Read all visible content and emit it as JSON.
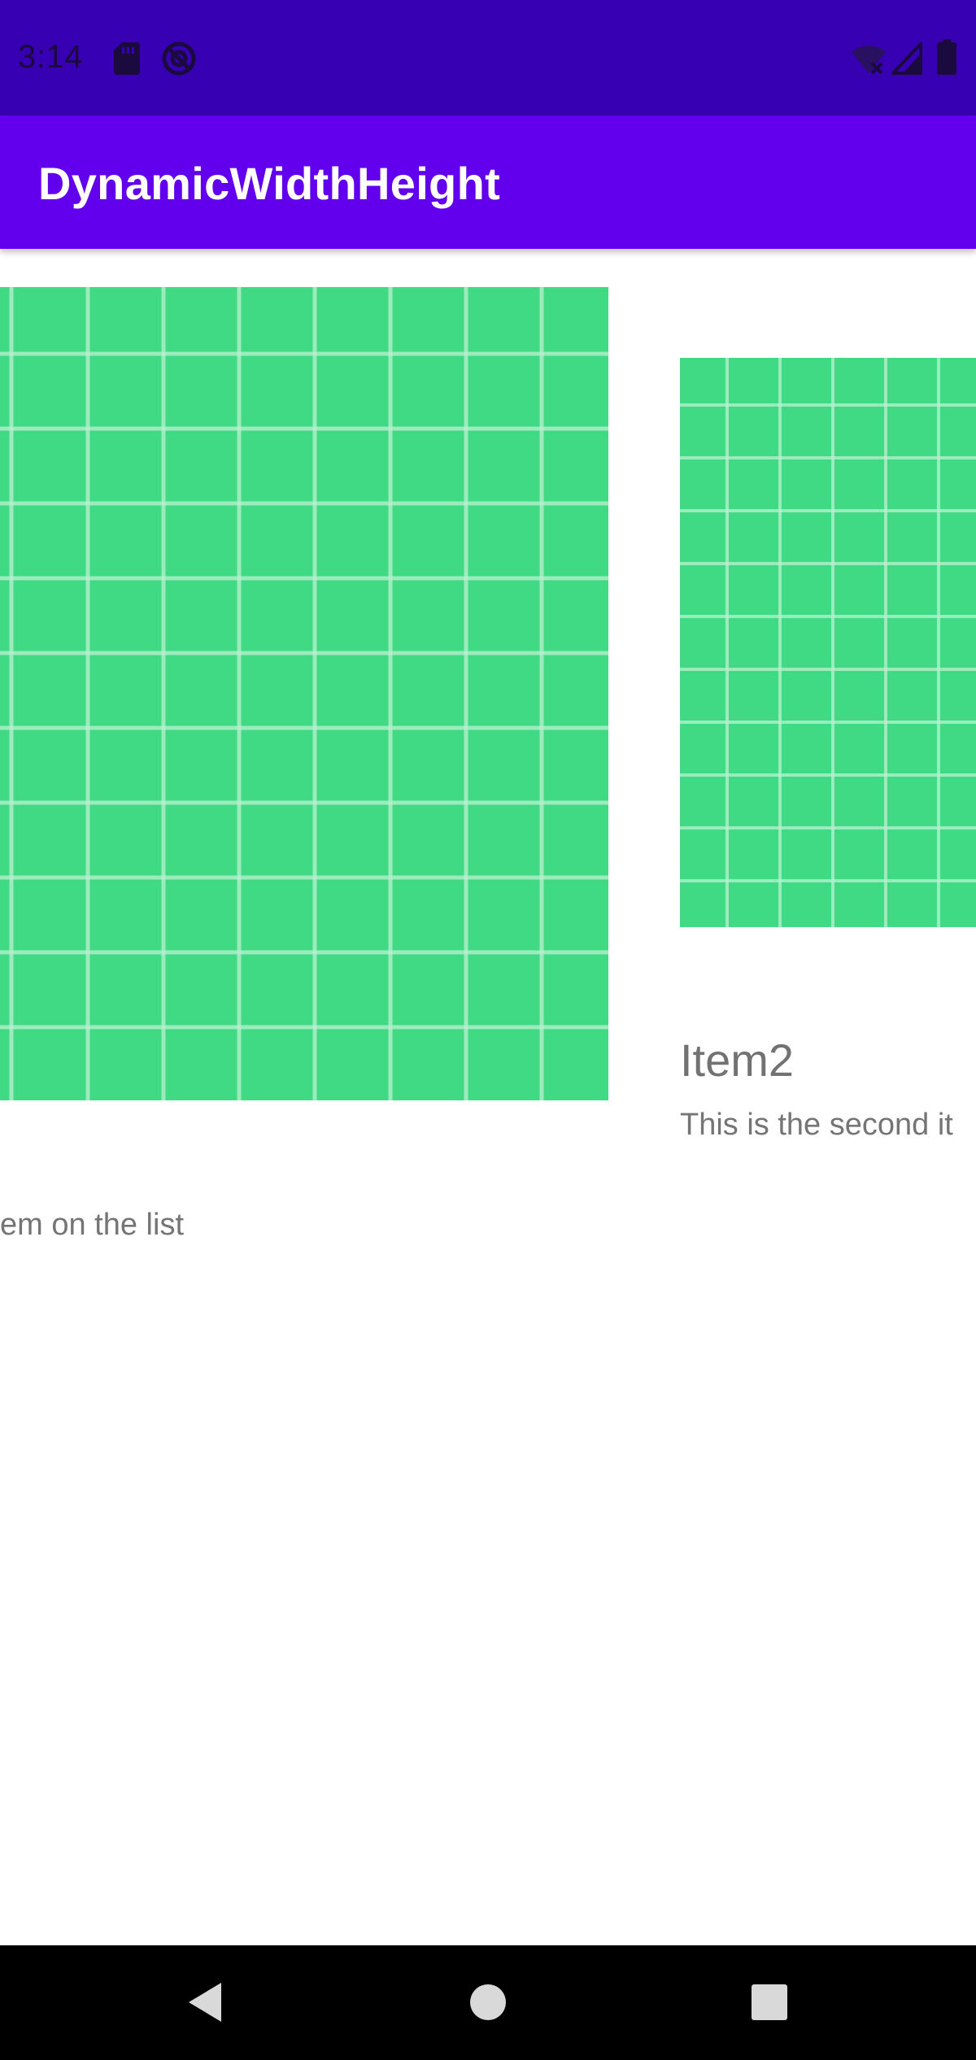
{
  "status_bar": {
    "time": "3:14",
    "icons_left": [
      "sd-card-icon",
      "do-not-disturb-icon"
    ],
    "icons_right": [
      "wifi-off-icon",
      "cell-signal-icon",
      "battery-icon"
    ],
    "color": "#3700b3"
  },
  "app_bar": {
    "title": "DynamicWidthHeight",
    "color": "#6200ee"
  },
  "list": {
    "items": [
      {
        "title": "",
        "description": "em on the list",
        "image_color": "#41da84"
      },
      {
        "title": "Item2",
        "description": "This is the second it",
        "image_color": "#41da84"
      }
    ]
  },
  "nav_bar": {
    "buttons": [
      "back-icon",
      "home-icon",
      "recents-icon"
    ]
  }
}
